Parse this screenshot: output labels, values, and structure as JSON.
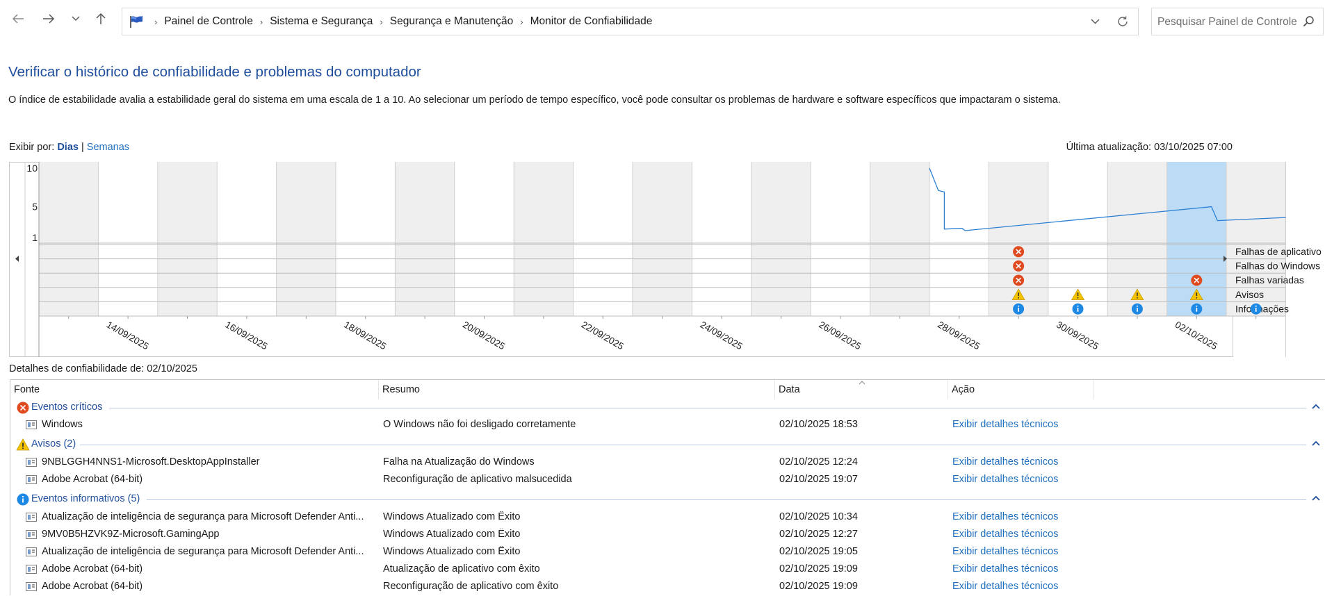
{
  "breadcrumb": [
    "Painel de Controle",
    "Sistema e Segurança",
    "Segurança e Manutenção",
    "Monitor de Confiabilidade"
  ],
  "search": {
    "placeholder": "Pesquisar Painel de Controle"
  },
  "page": {
    "title": "Verificar o histórico de confiabilidade e problemas do computador",
    "description": "O índice de estabilidade avalia a estabilidade geral do sistema em uma escala de 1 a 10. Ao selecionar um período de tempo específico, você pode consultar os problemas de hardware e software específicos que impactaram o sistema.",
    "view_by_label": "Exibir por:",
    "view_days": "Dias",
    "view_sep": "|",
    "view_weeks": "Semanas",
    "last_update": "Última atualização: 03/10/2025 07:00",
    "details_label": "Detalhes de confiabilidade de: 02/10/2025"
  },
  "chart_data": {
    "type": "line",
    "title": "",
    "y_ticks": [
      "10",
      "5",
      "1"
    ],
    "ylim": [
      1,
      10
    ],
    "columns": [
      "13/09/2025",
      "14/09/2025",
      "15/09/2025",
      "16/09/2025",
      "17/09/2025",
      "18/09/2025",
      "19/09/2025",
      "20/09/2025",
      "21/09/2025",
      "22/09/2025",
      "23/09/2025",
      "24/09/2025",
      "25/09/2025",
      "26/09/2025",
      "27/09/2025",
      "28/09/2025",
      "29/09/2025",
      "30/09/2025",
      "01/10/2025",
      "02/10/2025",
      "03/10/2025"
    ],
    "x_tick_labels": [
      "14/09/2025",
      "16/09/2025",
      "18/09/2025",
      "20/09/2025",
      "22/09/2025",
      "24/09/2025",
      "26/09/2025",
      "28/09/2025",
      "30/09/2025",
      "02/10/2025"
    ],
    "selected_column": "02/10/2025",
    "stability_index": [
      {
        "day": 15.0,
        "value": 10.0
      },
      {
        "day": 15.15,
        "value": 7.1
      },
      {
        "day": 15.25,
        "value": 6.9
      },
      {
        "day": 15.25,
        "value": 2.1
      },
      {
        "day": 15.55,
        "value": 2.2
      },
      {
        "day": 15.6,
        "value": 1.9
      },
      {
        "day": 19.75,
        "value": 5.0
      },
      {
        "day": 19.85,
        "value": 3.2
      },
      {
        "day": 21.0,
        "value": 3.6
      }
    ],
    "event_rows": [
      "Falhas de aplicativo",
      "Falhas do Windows",
      "Falhas variadas",
      "Avisos",
      "Informações"
    ],
    "events": [
      {
        "row": 0,
        "column": "29/09/2025",
        "kind": "error"
      },
      {
        "row": 1,
        "column": "29/09/2025",
        "kind": "error"
      },
      {
        "row": 2,
        "column": "29/09/2025",
        "kind": "error"
      },
      {
        "row": 2,
        "column": "02/10/2025",
        "kind": "error"
      },
      {
        "row": 3,
        "column": "29/09/2025",
        "kind": "warning"
      },
      {
        "row": 3,
        "column": "30/09/2025",
        "kind": "warning"
      },
      {
        "row": 3,
        "column": "01/10/2025",
        "kind": "warning"
      },
      {
        "row": 3,
        "column": "02/10/2025",
        "kind": "warning"
      },
      {
        "row": 4,
        "column": "29/09/2025",
        "kind": "info"
      },
      {
        "row": 4,
        "column": "30/09/2025",
        "kind": "info"
      },
      {
        "row": 4,
        "column": "01/10/2025",
        "kind": "info"
      },
      {
        "row": 4,
        "column": "02/10/2025",
        "kind": "info"
      },
      {
        "row": 4,
        "column": "03/10/2025",
        "kind": "info"
      }
    ],
    "colors": {
      "line": "#2b7fd4",
      "selected": "#bcdcf5",
      "shaded": "#efefef",
      "error": "#e04a1f",
      "warning": "#f5c400",
      "info": "#1e88e5"
    }
  },
  "table": {
    "headers": [
      "Fonte",
      "Resumo",
      "Data",
      "Ação"
    ],
    "groups": [
      {
        "label": "Eventos críticos",
        "icon": "error-icon",
        "rows": [
          {
            "source": "Windows",
            "summary": "O Windows não foi desligado corretamente",
            "date": "02/10/2025 18:53",
            "action": "Exibir detalhes técnicos"
          }
        ]
      },
      {
        "label": "Avisos (2)",
        "icon": "warning-icon",
        "rows": [
          {
            "source": "9NBLGGH4NNS1-Microsoft.DesktopAppInstaller",
            "summary": "Falha na Atualização do Windows",
            "date": "02/10/2025 12:24",
            "action": "Exibir detalhes técnicos"
          },
          {
            "source": "Adobe Acrobat (64-bit)",
            "summary": "Reconfiguração de aplicativo malsucedida",
            "date": "02/10/2025 19:07",
            "action": "Exibir detalhes técnicos"
          }
        ]
      },
      {
        "label": "Eventos informativos (5)",
        "icon": "info-icon",
        "rows": [
          {
            "source": "Atualização de inteligência de segurança para Microsoft Defender Anti...",
            "summary": "Windows Atualizado com Êxito",
            "date": "02/10/2025 10:34",
            "action": "Exibir detalhes técnicos"
          },
          {
            "source": "9MV0B5HZVK9Z-Microsoft.GamingApp",
            "summary": "Windows Atualizado com Êxito",
            "date": "02/10/2025 12:27",
            "action": "Exibir detalhes técnicos"
          },
          {
            "source": "Atualização de inteligência de segurança para Microsoft Defender Anti...",
            "summary": "Windows Atualizado com Êxito",
            "date": "02/10/2025 19:05",
            "action": "Exibir detalhes técnicos"
          },
          {
            "source": "Adobe Acrobat (64-bit)",
            "summary": "Atualização de aplicativo com êxito",
            "date": "02/10/2025 19:09",
            "action": "Exibir detalhes técnicos"
          },
          {
            "source": "Adobe Acrobat (64-bit)",
            "summary": "Reconfiguração de aplicativo com êxito",
            "date": "02/10/2025 19:09",
            "action": "Exibir detalhes técnicos"
          }
        ]
      }
    ]
  }
}
